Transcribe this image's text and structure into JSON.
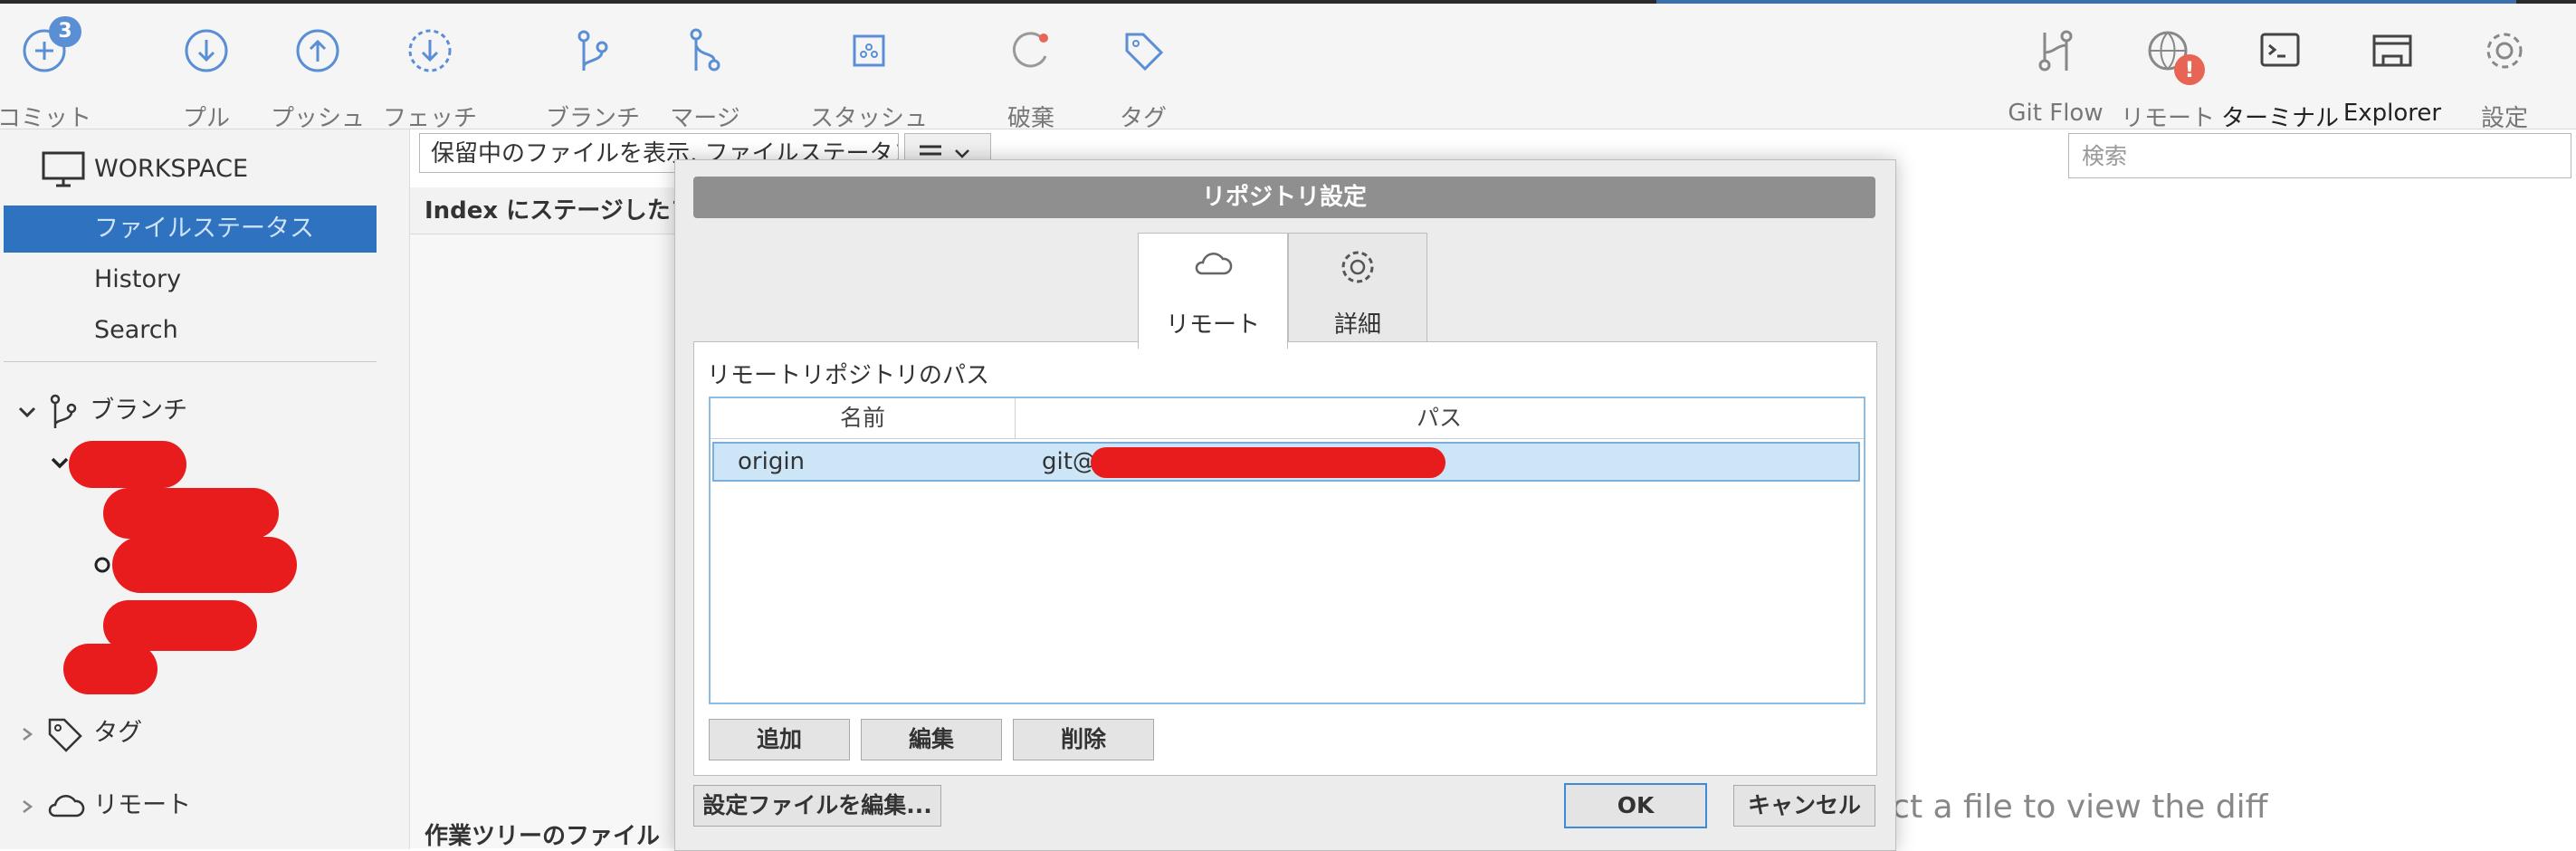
{
  "toolbar": {
    "commit_label": "コミット",
    "commit_badge": "3",
    "pull_label": "プル",
    "push_label": "プッシュ",
    "fetch_label": "フェッチ",
    "branch_label": "ブランチ",
    "merge_label": "マージ",
    "stash_label": "スタッシュ",
    "discard_label": "破棄",
    "tag_label": "タグ",
    "gitflow_label": "Git Flow",
    "remote_label": "リモート",
    "remote_warning": "!",
    "terminal_label": "ターミナル",
    "explorer_label": "Explorer",
    "settings_label": "設定"
  },
  "sidebar": {
    "workspace_title": "WORKSPACE",
    "items": [
      {
        "label": "ファイルステータス",
        "selected": true
      },
      {
        "label": "History",
        "selected": false
      },
      {
        "label": "Search",
        "selected": false
      }
    ],
    "branches_label": "ブランチ",
    "tags_label": "タグ",
    "remotes_label": "リモート"
  },
  "main": {
    "filter_value": "保留中のファイルを表示, ファイルステータス順",
    "search_placeholder": "検索",
    "index_header": "Index にステージしたファイル",
    "worktree_header": "作業ツリーのファイル",
    "diff_hint": "ect a file to view the diff"
  },
  "dialog": {
    "title": "リポジトリ設定",
    "tabs": [
      {
        "label": "リモート",
        "active": true,
        "icon": "cloud-icon"
      },
      {
        "label": "詳細",
        "active": false,
        "icon": "gear-icon"
      }
    ],
    "panel_title": "リモートリポジトリのパス",
    "columns": {
      "name": "名前",
      "path": "パス"
    },
    "rows": [
      {
        "name": "origin",
        "path": "git@"
      }
    ],
    "add_button": "追加",
    "edit_button": "編集",
    "delete_button": "削除",
    "edit_config_button": "設定ファイルを編集...",
    "ok_button": "OK",
    "cancel_button": "キャンセル"
  }
}
